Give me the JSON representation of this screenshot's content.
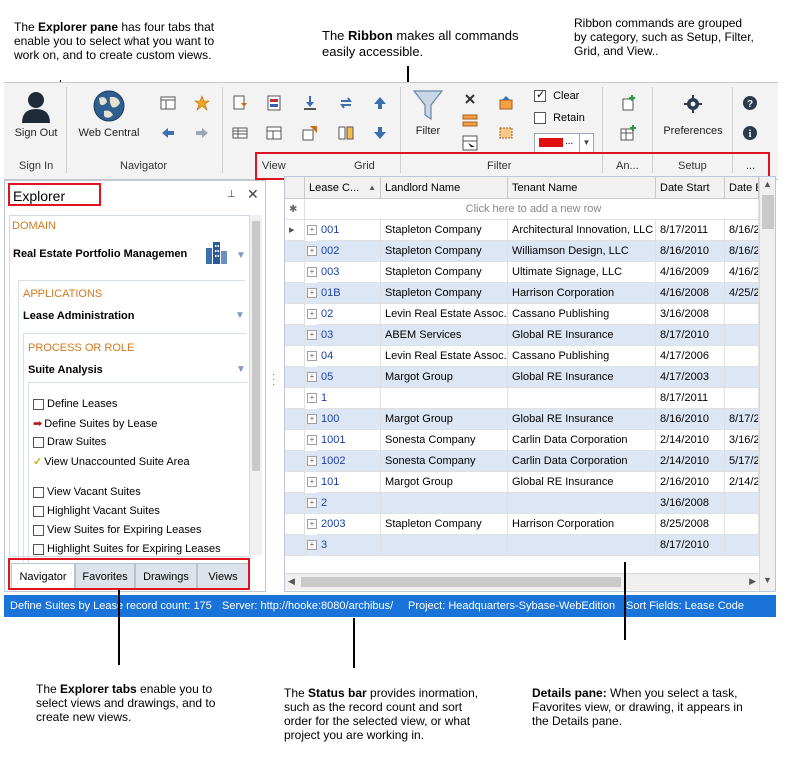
{
  "callouts": {
    "explorer_pane": {
      "bold": "Explorer pane",
      "pre": "The ",
      "post": " has four tabs that enable you to select what you want to work on, and to create custom views."
    },
    "ribbon": {
      "pre": "The ",
      "bold": "Ribbon",
      "post": " makes all commands easily accessible."
    },
    "ribbon_groups": "Ribbon commands are grouped by category, such as Setup, Filter, Grid, and View..",
    "explorer_tabs": {
      "pre": "The ",
      "bold": "Explorer tabs",
      "post": " enable you to select views and drawings, and to create new views."
    },
    "status_bar": {
      "pre": "The ",
      "bold": "Status bar",
      "post": " provides inormation, such as the record count and sort order for the selected view, or what project you are working in."
    },
    "details_pane": {
      "bold": "Details pane:",
      "post": " When you select a task, Favorites view, or drawing, it appears in the Details pane."
    }
  },
  "ribbon": {
    "sign_out": "Sign Out",
    "web_central": "Web Central",
    "filter": "Filter",
    "clear": "Clear",
    "retain": "Retain",
    "preferences": "Preferences",
    "color_dots": "...",
    "groups": {
      "sign_in": "Sign In",
      "navigator": "Navigator",
      "view": "View",
      "grid": "Grid",
      "filter": "Filter",
      "an": "An...",
      "setup": "Setup",
      "more": "..."
    }
  },
  "explorer": {
    "title": "Explorer",
    "domain_label": "DOMAIN",
    "domain_value": "Real Estate Portfolio Managemen",
    "applications_label": "APPLICATIONS",
    "applications_value": "Lease Administration",
    "process_label": "PROCESS OR ROLE",
    "process_value": "Suite Analysis",
    "tasks": [
      "Define Leases",
      "Define Suites by Lease",
      "Draw Suites",
      "View Unaccounted Suite Area",
      "View Vacant Suites",
      "Highlight Vacant Suites",
      "View Suites for Expiring Leases",
      "Highlight Suites for Expiring Leases"
    ],
    "tabs": [
      "Navigator",
      "Favorites",
      "Drawings",
      "Views"
    ]
  },
  "grid": {
    "columns": [
      "Lease C...",
      "Landlord Name",
      "Tenant Name",
      "Date Start",
      "Date E"
    ],
    "new_row_hint": "Click here to add a new row",
    "rows": [
      [
        "001",
        "Stapleton Company",
        "Architectural Innovation, LLC",
        "8/17/2011",
        "8/16/2"
      ],
      [
        "002",
        "Stapleton Company",
        "Williamson Design, LLC",
        "8/16/2010",
        "8/16/2"
      ],
      [
        "003",
        "Stapleton Company",
        "Ultimate Signage, LLC",
        "4/16/2009",
        "4/16/2"
      ],
      [
        "01B",
        "Stapleton Company",
        "Harrison Corporation",
        "4/16/2008",
        "4/25/2"
      ],
      [
        "02",
        "Levin Real Estate Assoc.",
        "Cassano Publishing",
        "3/16/2008",
        ""
      ],
      [
        "03",
        "ABEM Services",
        "Global RE Insurance",
        "8/17/2010",
        ""
      ],
      [
        "04",
        "Levin Real Estate Assoc.",
        "Cassano Publishing",
        "4/17/2006",
        ""
      ],
      [
        "05",
        "Margot Group",
        "Global RE Insurance",
        "4/17/2003",
        ""
      ],
      [
        "1",
        "",
        "",
        "8/17/2011",
        ""
      ],
      [
        "100",
        "Margot Group",
        "Global RE Insurance",
        "8/16/2010",
        "8/17/2"
      ],
      [
        "1001",
        "Sonesta Company",
        "Carlin Data Corporation",
        "2/14/2010",
        "3/16/2"
      ],
      [
        "1002",
        "Sonesta Company",
        "Carlin Data Corporation",
        "2/14/2010",
        "5/17/2"
      ],
      [
        "101",
        "Margot Group",
        "Global RE Insurance",
        "2/16/2010",
        "2/14/2"
      ],
      [
        "2",
        "",
        "",
        "3/16/2008",
        ""
      ],
      [
        "2003",
        "Stapleton Company",
        "Harrison Corporation",
        "8/25/2008",
        ""
      ],
      [
        "3",
        "",
        "",
        "8/17/2010",
        ""
      ]
    ]
  },
  "status": {
    "record": "Define Suites by Lease record count: 175",
    "server": "Server: http://hooke:8080/archibus/",
    "project": "Project: Headquarters-Sybase-WebEdition",
    "sort": "Sort Fields: Lease Code"
  },
  "colors": {
    "status_bar": "#1a73d9",
    "highlight_box": "#e0141e",
    "alt_row": "#dde6f4",
    "orange_label": "#d2781e"
  }
}
